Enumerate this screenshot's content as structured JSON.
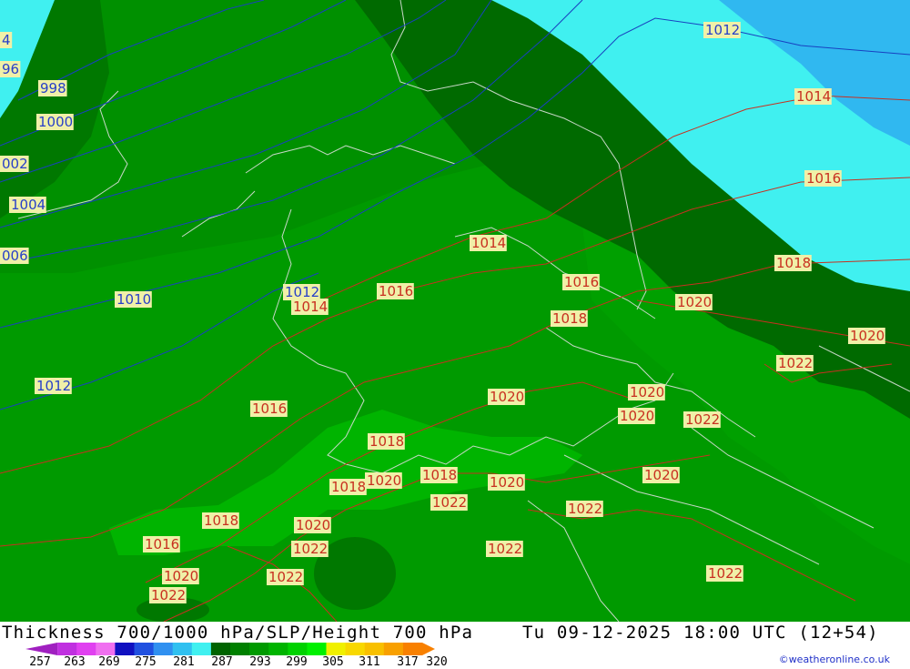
{
  "map": {
    "isobar_labels": [
      {
        "text": "4",
        "color": "blue"
      },
      {
        "text": "96",
        "color": "blue"
      },
      {
        "text": "998",
        "color": "blue"
      },
      {
        "text": "1000",
        "color": "blue"
      },
      {
        "text": "002",
        "color": "blue"
      },
      {
        "text": "1004",
        "color": "blue"
      },
      {
        "text": "006",
        "color": "blue"
      },
      {
        "text": "1010",
        "color": "blue"
      },
      {
        "text": "1012",
        "color": "blue"
      },
      {
        "text": "1012",
        "color": "blue"
      },
      {
        "text": "1012",
        "color": "blue"
      },
      {
        "text": "1014",
        "color": "red"
      },
      {
        "text": "1014",
        "color": "red"
      },
      {
        "text": "1014",
        "color": "red"
      },
      {
        "text": "1016",
        "color": "red"
      },
      {
        "text": "1016",
        "color": "red"
      },
      {
        "text": "1016",
        "color": "red"
      },
      {
        "text": "1016",
        "color": "red"
      },
      {
        "text": "1016",
        "color": "red"
      },
      {
        "text": "1018",
        "color": "red"
      },
      {
        "text": "1018",
        "color": "red"
      },
      {
        "text": "1018",
        "color": "red"
      },
      {
        "text": "1018",
        "color": "red"
      },
      {
        "text": "1018",
        "color": "red"
      },
      {
        "text": "1018",
        "color": "red"
      },
      {
        "text": "1020",
        "color": "red"
      },
      {
        "text": "1020",
        "color": "red"
      },
      {
        "text": "1020",
        "color": "red"
      },
      {
        "text": "1020",
        "color": "red"
      },
      {
        "text": "1020",
        "color": "red"
      },
      {
        "text": "1020",
        "color": "red"
      },
      {
        "text": "1020",
        "color": "red"
      },
      {
        "text": "1020",
        "color": "red"
      },
      {
        "text": "1020",
        "color": "red"
      },
      {
        "text": "1020",
        "color": "red"
      },
      {
        "text": "1022",
        "color": "red"
      },
      {
        "text": "1022",
        "color": "red"
      },
      {
        "text": "1022",
        "color": "red"
      },
      {
        "text": "1022",
        "color": "red"
      },
      {
        "text": "1022",
        "color": "red"
      },
      {
        "text": "1022",
        "color": "red"
      },
      {
        "text": "1022",
        "color": "red"
      },
      {
        "text": "1022",
        "color": "red"
      },
      {
        "text": "1022",
        "color": "red"
      }
    ]
  },
  "footer": {
    "title": "Thickness 700/1000 hPa/SLP/Height 700 hPa",
    "valid_time": "Tu 09-12-2025 18:00 UTC (12+54)",
    "credit": "©weatheronline.co.uk",
    "scale": {
      "colors": [
        "#a020c0",
        "#c030e0",
        "#e040f0",
        "#f070f0",
        "#1010c0",
        "#2050e0",
        "#3090f0",
        "#30c0f0",
        "#40f0f0",
        "#006400",
        "#008000",
        "#009a00",
        "#00b400",
        "#00d200",
        "#00f000",
        "#f0f000",
        "#f8d800",
        "#f8c000",
        "#f8a000",
        "#f88000"
      ],
      "ticks": [
        "257",
        "263",
        "269",
        "275",
        "281",
        "287",
        "293",
        "299",
        "305",
        "311",
        "317",
        "320"
      ]
    }
  }
}
